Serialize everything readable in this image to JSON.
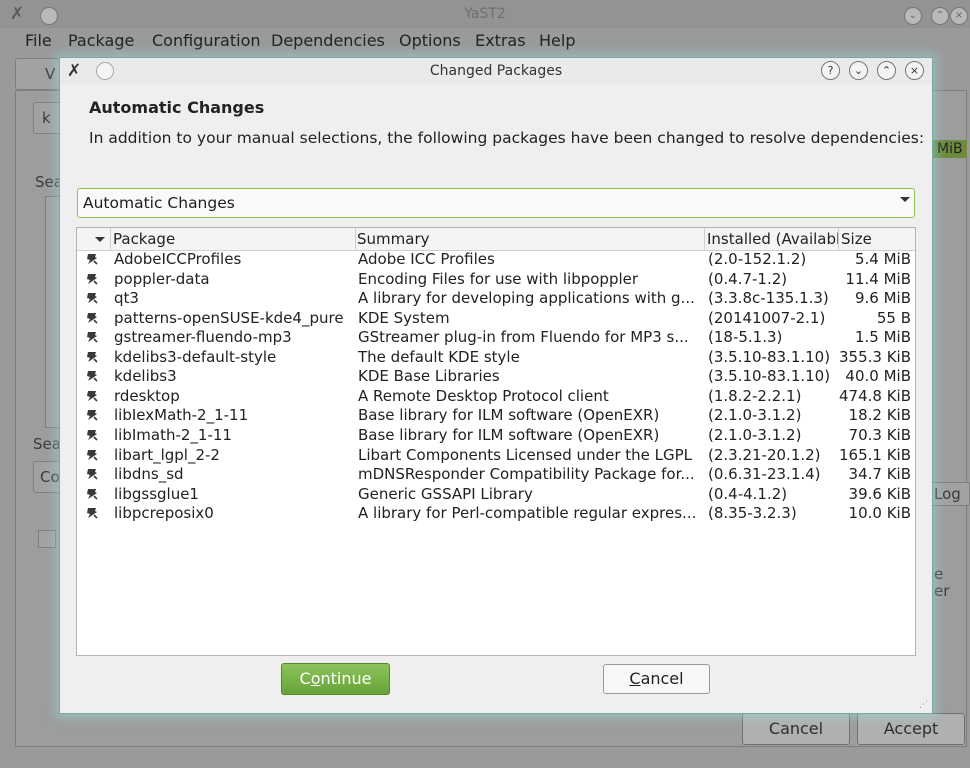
{
  "main_window": {
    "title": "YaST2",
    "menu": [
      {
        "label": "File"
      },
      {
        "label": "Package"
      },
      {
        "label": "Configuration"
      },
      {
        "label": "Dependencies"
      },
      {
        "label": "Options"
      },
      {
        "label": "Extras"
      },
      {
        "label": "Help"
      }
    ],
    "visible_fragments": {
      "tab_fragment": "V",
      "field_fragment": "k",
      "search_label_fragment": "Sea",
      "search_label_fragment_2": "Sea",
      "combo_fragment": "Co",
      "size_fragment": "MiB",
      "log_fragment": "Log",
      "text_fragment_1": "e",
      "text_fragment_2": "er"
    },
    "cancel_label": "Cancel",
    "accept_label": "Accept"
  },
  "dialog": {
    "title": "Changed Packages",
    "heading": "Automatic Changes",
    "description": "In addition to your manual selections, the following packages have been changed to resolve dependencies:",
    "filter": {
      "selected": "Automatic Changes"
    },
    "columns": {
      "package": "Package",
      "summary": "Summary",
      "installed": "Installed (Available)",
      "size": "Size"
    },
    "rows": [
      {
        "package": "AdobeICCProfiles",
        "summary": "Adobe ICC Profiles",
        "installed": "(2.0-152.1.2)",
        "size": "5.4 MiB"
      },
      {
        "package": "poppler-data",
        "summary": "Encoding Files for use with libpoppler",
        "installed": "(0.4.7-1.2)",
        "size": "11.4 MiB"
      },
      {
        "package": "qt3",
        "summary": "A library for developing applications with g...",
        "installed": "(3.3.8c-135.1.3)",
        "size": "9.6 MiB"
      },
      {
        "package": "patterns-openSUSE-kde4_pure",
        "summary": "KDE System",
        "installed": "(20141007-2.1)",
        "size": "55 B"
      },
      {
        "package": "gstreamer-fluendo-mp3",
        "summary": "GStreamer plug-in from Fluendo for MP3 s...",
        "installed": "(18-5.1.3)",
        "size": "1.5 MiB"
      },
      {
        "package": "kdelibs3-default-style",
        "summary": "The default KDE style",
        "installed": "(3.5.10-83.1.10)",
        "size": "355.3 KiB"
      },
      {
        "package": "kdelibs3",
        "summary": "KDE Base Libraries",
        "installed": "(3.5.10-83.1.10)",
        "size": "40.0 MiB"
      },
      {
        "package": "rdesktop",
        "summary": "A Remote Desktop Protocol client",
        "installed": "(1.8.2-2.2.1)",
        "size": "474.8 KiB"
      },
      {
        "package": "libIexMath-2_1-11",
        "summary": "Base library for ILM software (OpenEXR)",
        "installed": "(2.1.0-3.1.2)",
        "size": "18.2 KiB"
      },
      {
        "package": "libImath-2_1-11",
        "summary": "Base library for ILM software (OpenEXR)",
        "installed": "(2.1.0-3.1.2)",
        "size": "70.3 KiB"
      },
      {
        "package": "libart_lgpl_2-2",
        "summary": "Libart Components Licensed under the LGPL",
        "installed": "(2.3.21-20.1.2)",
        "size": "165.1 KiB"
      },
      {
        "package": "libdns_sd",
        "summary": "mDNSResponder Compatibility Package for...",
        "installed": "(0.6.31-23.1.4)",
        "size": "34.7 KiB"
      },
      {
        "package": "libgssglue1",
        "summary": "Generic GSSAPI Library",
        "installed": "(0.4-4.1.2)",
        "size": "39.6 KiB"
      },
      {
        "package": "libpcreposix0",
        "summary": "A library for Perl-compatible regular expres...",
        "installed": "(8.35-3.2.3)",
        "size": "10.0 KiB"
      }
    ],
    "buttons": {
      "continue": {
        "first": "C",
        "accel": "o",
        "rest": "ntinue"
      },
      "cancel": {
        "accel": "C",
        "rest": "ancel"
      }
    }
  },
  "icons": {
    "row_status": "auto-install-icon",
    "title_buttons": [
      "help-icon",
      "minimize-icon",
      "maximize-icon",
      "close-icon"
    ]
  },
  "colors": {
    "accent_green": "#7ab648",
    "dialog_glow": "#96e1dc"
  }
}
